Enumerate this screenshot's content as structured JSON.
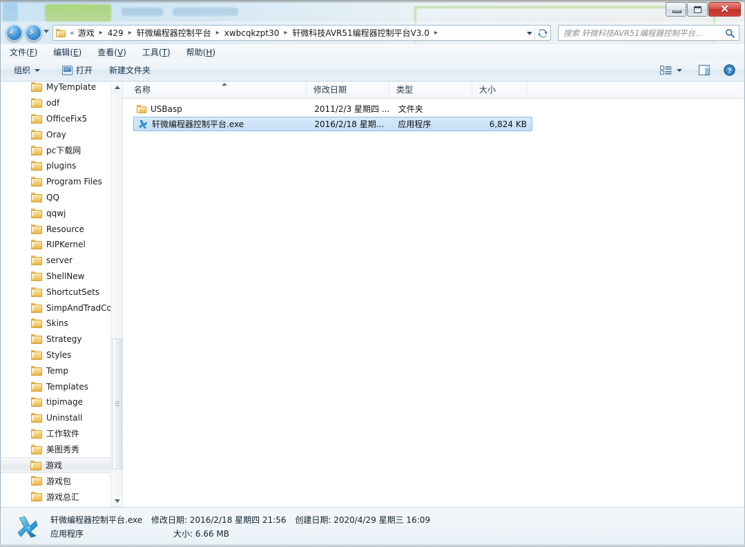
{
  "window": {
    "title": "",
    "buttons": {
      "minimize": "–",
      "maximize": "❐",
      "close": "✕"
    }
  },
  "addressbar": {
    "back_label": "‹",
    "forward_label": "›",
    "double_chevron": "«",
    "crumbs": [
      "游戏",
      "429",
      "轩微编程器控制平台",
      "xwbcqkzpt30",
      "轩微科技AVR51编程器控制平台V3.0"
    ],
    "chevron": "▸",
    "refresh_icon": "refresh-icon",
    "search_placeholder": "搜索 轩微科技AVR51编程器控制平台..."
  },
  "menubar": {
    "items": [
      {
        "text": "文件",
        "key": "F"
      },
      {
        "text": "编辑",
        "key": "E"
      },
      {
        "text": "查看",
        "key": "V"
      },
      {
        "text": "工具",
        "key": "T"
      },
      {
        "text": "帮助",
        "key": "H"
      }
    ]
  },
  "toolbar": {
    "organize": "组织",
    "open": "打开",
    "new_folder": "新建文件夹",
    "view_icon": "view-layout-icon",
    "preview_icon": "preview-pane-icon",
    "help_icon": "help-icon"
  },
  "navpane": {
    "items": [
      {
        "label": "MyTemplate",
        "selected": false
      },
      {
        "label": "odf",
        "selected": false
      },
      {
        "label": "OfficeFix5",
        "selected": false
      },
      {
        "label": "Oray",
        "selected": false
      },
      {
        "label": "pc下载网",
        "selected": false
      },
      {
        "label": "plugins",
        "selected": false
      },
      {
        "label": "Program Files",
        "selected": false
      },
      {
        "label": "QQ",
        "selected": false
      },
      {
        "label": "qqwj",
        "selected": false
      },
      {
        "label": "Resource",
        "selected": false
      },
      {
        "label": "RIPKernel",
        "selected": false
      },
      {
        "label": "server",
        "selected": false
      },
      {
        "label": "ShellNew",
        "selected": false
      },
      {
        "label": "ShortcutSets",
        "selected": false
      },
      {
        "label": "SimpAndTradCo",
        "selected": false
      },
      {
        "label": "Skins",
        "selected": false
      },
      {
        "label": "Strategy",
        "selected": false
      },
      {
        "label": "Styles",
        "selected": false
      },
      {
        "label": "Temp",
        "selected": false
      },
      {
        "label": "Templates",
        "selected": false
      },
      {
        "label": "tipimage",
        "selected": false
      },
      {
        "label": "Uninstall",
        "selected": false
      },
      {
        "label": "工作软件",
        "selected": false
      },
      {
        "label": "美图秀秀",
        "selected": false
      },
      {
        "label": "游戏",
        "selected": true
      },
      {
        "label": "游戏包",
        "selected": false
      },
      {
        "label": "游戏总汇",
        "selected": false
      }
    ]
  },
  "filelist": {
    "columns": [
      {
        "label": "名称",
        "sorted": "asc"
      },
      {
        "label": "修改日期",
        "sorted": ""
      },
      {
        "label": "类型",
        "sorted": ""
      },
      {
        "label": "大小",
        "sorted": ""
      }
    ],
    "rows": [
      {
        "name": "USBasp",
        "date": "2011/2/3 星期四 ...",
        "type": "文件夹",
        "size": "",
        "icon": "folder-icon",
        "selected": false
      },
      {
        "name": "轩微编程器控制平台.exe",
        "date": "2016/2/18 星期...",
        "type": "应用程序",
        "size": "6,824 KB",
        "icon": "application-icon",
        "selected": true
      }
    ]
  },
  "statusbar": {
    "filename": "轩微编程器控制平台.exe",
    "modified_key": "修改日期:",
    "modified_value": "2016/2/18 星期四 21:56",
    "created_key": "创建日期:",
    "created_value": "2020/4/29 星期三 16:09",
    "type": "应用程序",
    "size_key": "大小:",
    "size_value": "6.66 MB",
    "icon": "application-icon"
  },
  "colors": {
    "selection_fill": "#cce2f7",
    "selection_border": "#8fbce4",
    "close_button": "#c1312c",
    "folder_gold": "#eab545",
    "app_icon_blue": "#2e9bd4"
  }
}
